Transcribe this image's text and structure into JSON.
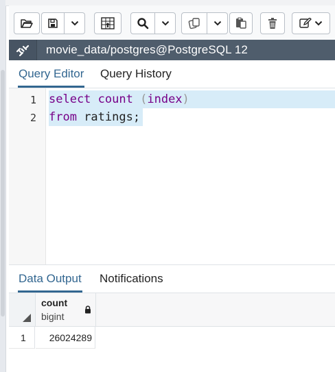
{
  "toolbar": {
    "buttons": [
      {
        "icon": "folder-open-icon"
      },
      {
        "icon": "save-icon"
      },
      {
        "icon": "chevron-down-icon"
      },
      {
        "icon": "grid-filter-icon"
      },
      {
        "icon": "search-icon"
      },
      {
        "icon": "chevron-down-icon"
      },
      {
        "icon": "copy-icon"
      },
      {
        "icon": "chevron-down-icon"
      },
      {
        "icon": "paste-icon"
      },
      {
        "icon": "trash-icon"
      },
      {
        "icon": "edit-icon"
      }
    ]
  },
  "connection": {
    "icon": "connection-link-icon",
    "title": "movie_data/postgres@PostgreSQL 12"
  },
  "editor_tabs": [
    {
      "label": "Query Editor",
      "active": true
    },
    {
      "label": "Query History",
      "active": false
    }
  ],
  "editor": {
    "lines": [
      {
        "number": "1",
        "kw1": "select",
        "kw2": "count",
        "open": "(",
        "arg": "index",
        "close": ")"
      },
      {
        "number": "2",
        "kw1": "from",
        "rest": " ratings;"
      }
    ]
  },
  "result_tabs": [
    {
      "label": "Data Output",
      "active": true
    },
    {
      "label": "Notifications",
      "active": false
    }
  ],
  "grid": {
    "columns": [
      {
        "name": "count",
        "type": "bigint",
        "icon": "lock-icon"
      }
    ],
    "rows": [
      {
        "row_number": "1",
        "values": [
          "26024289"
        ]
      }
    ]
  },
  "colors": {
    "accent": "#326690",
    "connection_bar": "#4f5d6c",
    "keyword": "#770088",
    "line_highlight": "#d7ecf8"
  }
}
